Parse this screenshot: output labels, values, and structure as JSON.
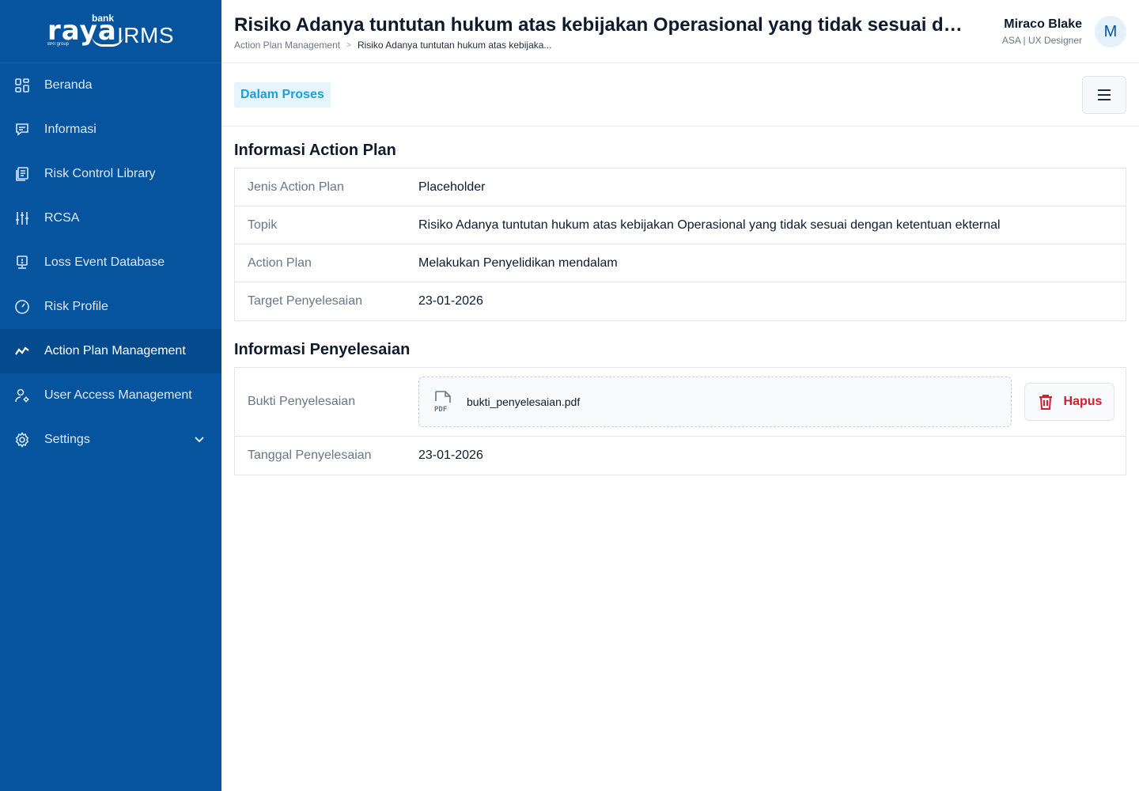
{
  "brand": {
    "small": "bank",
    "name": "raya",
    "product": "IRMS",
    "group": "BRI group"
  },
  "sidebar": {
    "items": [
      {
        "label": "Beranda",
        "icon": "dashboard-icon"
      },
      {
        "label": "Informasi",
        "icon": "message-icon"
      },
      {
        "label": "Risk Control Library",
        "icon": "library-icon"
      },
      {
        "label": "RCSA",
        "icon": "sliders-icon"
      },
      {
        "label": "Loss Event Database",
        "icon": "monitor-icon"
      },
      {
        "label": "Risk Profile",
        "icon": "gauge-icon"
      },
      {
        "label": "Action Plan Management",
        "icon": "trend-icon",
        "active": true
      },
      {
        "label": "User Access Management",
        "icon": "user-gear-icon"
      },
      {
        "label": "Settings",
        "icon": "gear-icon",
        "expandable": true
      }
    ]
  },
  "header": {
    "title": "Risiko Adanya tuntutan hukum atas kebijakan Operasional yang tidak sesuai dengan...",
    "breadcrumb": {
      "parent": "Action Plan Management",
      "separator": ">",
      "current": "Risiko Adanya tuntutan hukum atas kebijaka..."
    },
    "user": {
      "name": "Miraco Blake",
      "role": "ASA | UX Designer",
      "initial": "M"
    }
  },
  "toolbar": {
    "status": "Dalam Proses"
  },
  "action_plan": {
    "title": "Informasi Action Plan",
    "rows": [
      {
        "key": "Jenis Action Plan",
        "value": "Placeholder"
      },
      {
        "key": "Topik",
        "value": "Risiko Adanya tuntutan hukum atas kebijakan Operasional yang tidak sesuai dengan ketentuan ekternal"
      },
      {
        "key": "Action Plan",
        "value": "Melakukan Penyelidikan mendalam"
      },
      {
        "key": "Target Penyelesaian",
        "value": "23-01-2026"
      }
    ]
  },
  "completion": {
    "title": "Informasi Penyelesaian",
    "proof_label": "Bukti Penyelesaian",
    "file_name": "bukti_penyelesaian.pdf",
    "file_type": "PDF",
    "delete_label": "Hapus",
    "date_label": "Tanggal Penyelesaian",
    "date_value": "23-01-2026"
  },
  "colors": {
    "sidebar": "#06549e",
    "sidebar_active": "#044a8c",
    "status_badge_text": "#1aa0d8",
    "status_badge_bg": "#e6f4fb",
    "danger": "#cc1f2f"
  }
}
